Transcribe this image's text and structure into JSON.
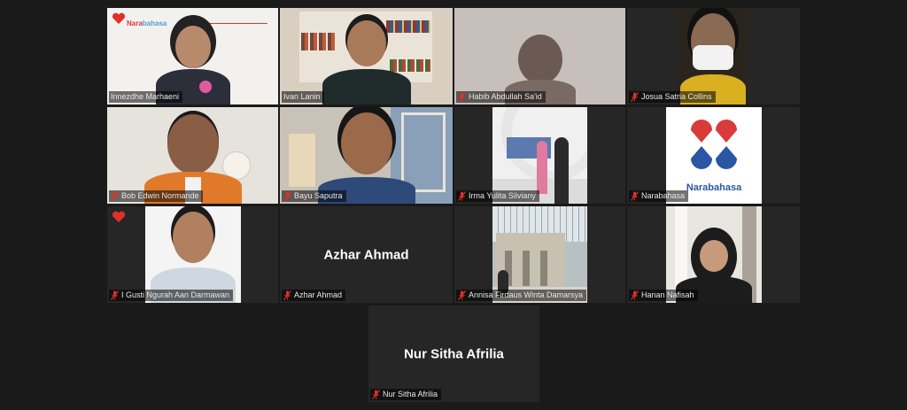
{
  "participants": [
    {
      "name": "Innezdhe Marhaeni",
      "muted": false
    },
    {
      "name": "Ivan Lanin",
      "muted": false
    },
    {
      "name": "Habib Abdullah Sa'id",
      "muted": true
    },
    {
      "name": "Josua Satria Collins",
      "muted": true
    },
    {
      "name": "Bob Edwin Normande",
      "muted": true
    },
    {
      "name": "Bayu Saputra",
      "muted": true
    },
    {
      "name": "Irma Yulita Silviany",
      "muted": true
    },
    {
      "name": "Narabahasa",
      "muted": true
    },
    {
      "name": "I Gusti Ngurah Aan Darmawan",
      "muted": true
    },
    {
      "name": "Azhar Ahmad",
      "muted": true
    },
    {
      "name": "Annisa Firdaus Winta Damarsya",
      "muted": true
    },
    {
      "name": "Hanan Nafisah",
      "muted": true
    },
    {
      "name": "Nur Sitha Afrilia",
      "muted": true
    }
  ],
  "video_off": {
    "azhar": "Azhar Ahmad",
    "nur": "Nur Sitha Afrilia"
  },
  "branding": {
    "narabahasa_small_a": "Nara",
    "narabahasa_small_b": "bahasa",
    "narabahasa_logo_text": "Narabahasa"
  },
  "colors": {
    "active_speaker": "#c8e64a",
    "mic_muted": "#e0302a",
    "tile_bg": "#262626",
    "page_bg": "#1a1a1a",
    "heart": "#e0302a"
  },
  "icons": {
    "muted": "mic-muted-icon",
    "reaction": "heart-icon"
  }
}
